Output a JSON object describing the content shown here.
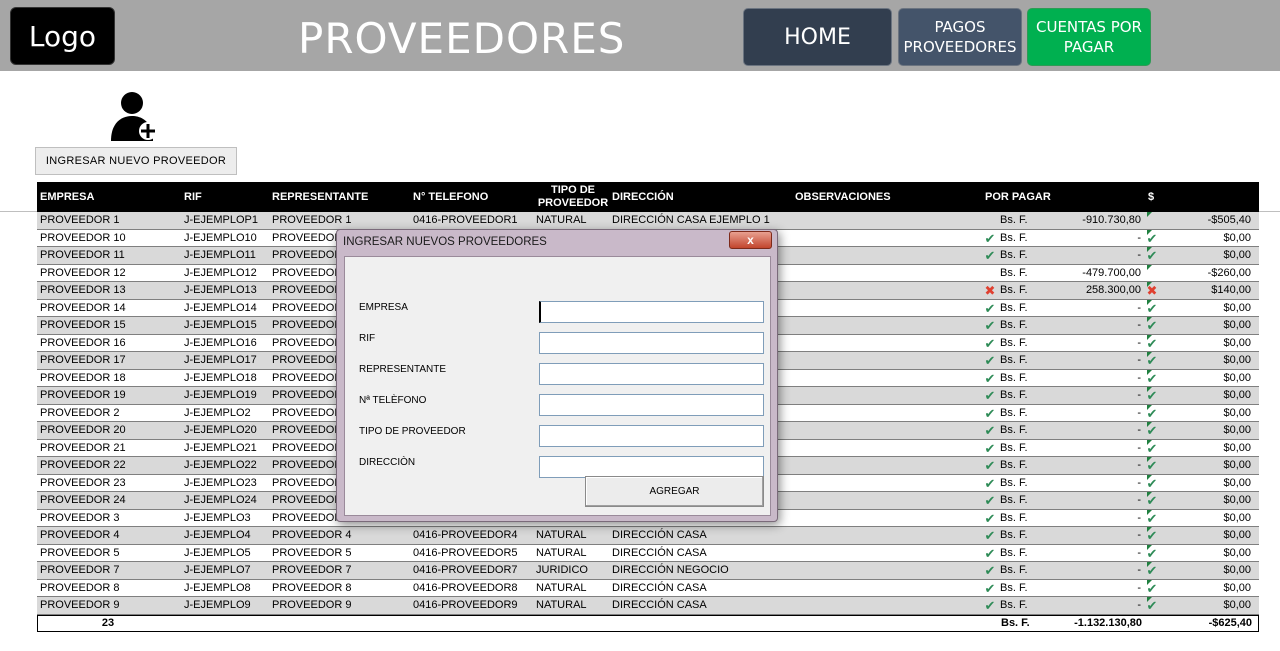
{
  "header": {
    "logo": "Logo",
    "title": "PROVEEDORES",
    "nav": {
      "home": "HOME",
      "pagos_line1": "PAGOS",
      "pagos_line2": "PROVEEDORES",
      "cuentas_line1": "CUENTAS POR",
      "cuentas_line2": "PAGAR"
    }
  },
  "new_provider_button": "INGRESAR NUEVO PROVEEDOR",
  "table": {
    "columns": {
      "empresa": "EMPRESA",
      "rif": "RIF",
      "representante": "REPRESENTANTE",
      "telefono": "N° TELEFONO",
      "tipo_line1": "TIPO DE",
      "tipo_line2": "PROVEEDOR",
      "direccion": "DIRECCIÓN",
      "observaciones": "OBSERVACIONES",
      "por_pagar": "POR PAGAR",
      "usd": "$"
    },
    "rows": [
      {
        "empresa": "PROVEEDOR 1",
        "rif": "J-EJEMPLOP1",
        "rep": "PROVEEDOR 1",
        "tel": "0416-PROVEEDOR1",
        "tipo": "NATURAL",
        "dir": "DIRECCIÓN CASA EJEMPLO 1",
        "mark1": "",
        "bs": "Bs. F.",
        "porpagar": "-910.730,80",
        "mark2": "",
        "usd": "-$505,40"
      },
      {
        "empresa": "PROVEEDOR 10",
        "rif": "J-EJEMPLO10",
        "rep": "PROVEEDOR",
        "tel": "",
        "tipo": "",
        "dir": "",
        "mark1": "ok",
        "bs": "Bs. F.",
        "porpagar": "-",
        "mark2": "ok",
        "usd": "$0,00"
      },
      {
        "empresa": "PROVEEDOR 11",
        "rif": "J-EJEMPLO11",
        "rep": "PROVEEDOR",
        "tel": "",
        "tipo": "",
        "dir": "",
        "mark1": "ok",
        "bs": "Bs. F.",
        "porpagar": "-",
        "mark2": "ok",
        "usd": "$0,00"
      },
      {
        "empresa": "PROVEEDOR 12",
        "rif": "J-EJEMPLO12",
        "rep": "PROVEEDOR",
        "tel": "",
        "tipo": "",
        "dir": "",
        "mark1": "",
        "bs": "Bs. F.",
        "porpagar": "-479.700,00",
        "mark2": "",
        "usd": "-$260,00"
      },
      {
        "empresa": "PROVEEDOR 13",
        "rif": "J-EJEMPLO13",
        "rep": "PROVEEDOR",
        "tel": "",
        "tipo": "",
        "dir": "",
        "mark1": "bad",
        "bs": "Bs. F.",
        "porpagar": "258.300,00",
        "mark2": "bad",
        "usd": "$140,00"
      },
      {
        "empresa": "PROVEEDOR 14",
        "rif": "J-EJEMPLO14",
        "rep": "PROVEEDOR",
        "tel": "",
        "tipo": "",
        "dir": "",
        "mark1": "ok",
        "bs": "Bs. F.",
        "porpagar": "-",
        "mark2": "ok",
        "usd": "$0,00"
      },
      {
        "empresa": "PROVEEDOR 15",
        "rif": "J-EJEMPLO15",
        "rep": "PROVEEDOR",
        "tel": "",
        "tipo": "",
        "dir": "",
        "mark1": "ok",
        "bs": "Bs. F.",
        "porpagar": "-",
        "mark2": "ok",
        "usd": "$0,00"
      },
      {
        "empresa": "PROVEEDOR 16",
        "rif": "J-EJEMPLO16",
        "rep": "PROVEEDOR",
        "tel": "",
        "tipo": "",
        "dir": "",
        "mark1": "ok",
        "bs": "Bs. F.",
        "porpagar": "-",
        "mark2": "ok",
        "usd": "$0,00"
      },
      {
        "empresa": "PROVEEDOR 17",
        "rif": "J-EJEMPLO17",
        "rep": "PROVEEDOR",
        "tel": "",
        "tipo": "",
        "dir": "",
        "mark1": "ok",
        "bs": "Bs. F.",
        "porpagar": "-",
        "mark2": "ok",
        "usd": "$0,00"
      },
      {
        "empresa": "PROVEEDOR 18",
        "rif": "J-EJEMPLO18",
        "rep": "PROVEEDOR",
        "tel": "",
        "tipo": "",
        "dir": "",
        "mark1": "ok",
        "bs": "Bs. F.",
        "porpagar": "-",
        "mark2": "ok",
        "usd": "$0,00"
      },
      {
        "empresa": "PROVEEDOR 19",
        "rif": "J-EJEMPLO19",
        "rep": "PROVEEDOR",
        "tel": "",
        "tipo": "",
        "dir": "",
        "mark1": "ok",
        "bs": "Bs. F.",
        "porpagar": "-",
        "mark2": "ok",
        "usd": "$0,00"
      },
      {
        "empresa": "PROVEEDOR 2",
        "rif": "J-EJEMPLO2",
        "rep": "PROVEEDOR",
        "tel": "",
        "tipo": "",
        "dir": "",
        "mark1": "ok",
        "bs": "Bs. F.",
        "porpagar": "-",
        "mark2": "ok",
        "usd": "$0,00"
      },
      {
        "empresa": "PROVEEDOR 20",
        "rif": "J-EJEMPLO20",
        "rep": "PROVEEDOR",
        "tel": "",
        "tipo": "",
        "dir": "",
        "mark1": "ok",
        "bs": "Bs. F.",
        "porpagar": "-",
        "mark2": "ok",
        "usd": "$0,00"
      },
      {
        "empresa": "PROVEEDOR 21",
        "rif": "J-EJEMPLO21",
        "rep": "PROVEEDOR",
        "tel": "",
        "tipo": "",
        "dir": "",
        "mark1": "ok",
        "bs": "Bs. F.",
        "porpagar": "-",
        "mark2": "ok",
        "usd": "$0,00"
      },
      {
        "empresa": "PROVEEDOR 22",
        "rif": "J-EJEMPLO22",
        "rep": "PROVEEDOR",
        "tel": "",
        "tipo": "",
        "dir": "",
        "mark1": "ok",
        "bs": "Bs. F.",
        "porpagar": "-",
        "mark2": "ok",
        "usd": "$0,00"
      },
      {
        "empresa": "PROVEEDOR 23",
        "rif": "J-EJEMPLO23",
        "rep": "PROVEEDOR",
        "tel": "",
        "tipo": "",
        "dir": "",
        "mark1": "ok",
        "bs": "Bs. F.",
        "porpagar": "-",
        "mark2": "ok",
        "usd": "$0,00"
      },
      {
        "empresa": "PROVEEDOR 24",
        "rif": "J-EJEMPLO24",
        "rep": "PROVEEDOR",
        "tel": "",
        "tipo": "",
        "dir": "",
        "mark1": "ok",
        "bs": "Bs. F.",
        "porpagar": "-",
        "mark2": "ok",
        "usd": "$0,00"
      },
      {
        "empresa": "PROVEEDOR 3",
        "rif": "J-EJEMPLO3",
        "rep": "PROVEEDOR",
        "tel": "",
        "tipo": "",
        "dir": "",
        "mark1": "ok",
        "bs": "Bs. F.",
        "porpagar": "-",
        "mark2": "ok",
        "usd": "$0,00"
      },
      {
        "empresa": "PROVEEDOR 4",
        "rif": "J-EJEMPLO4",
        "rep": "PROVEEDOR 4",
        "tel": "0416-PROVEEDOR4",
        "tipo": "NATURAL",
        "dir": "DIRECCIÓN CASA",
        "mark1": "ok",
        "bs": "Bs. F.",
        "porpagar": "-",
        "mark2": "ok",
        "usd": "$0,00"
      },
      {
        "empresa": "PROVEEDOR 5",
        "rif": "J-EJEMPLO5",
        "rep": "PROVEEDOR 5",
        "tel": "0416-PROVEEDOR5",
        "tipo": "NATURAL",
        "dir": "DIRECCIÓN CASA",
        "mark1": "ok",
        "bs": "Bs. F.",
        "porpagar": "-",
        "mark2": "ok",
        "usd": "$0,00"
      },
      {
        "empresa": "PROVEEDOR 7",
        "rif": "J-EJEMPLO7",
        "rep": "PROVEEDOR 7",
        "tel": "0416-PROVEEDOR7",
        "tipo": "JURIDICO",
        "dir": "DIRECCIÓN NEGOCIO",
        "mark1": "ok",
        "bs": "Bs. F.",
        "porpagar": "-",
        "mark2": "ok",
        "usd": "$0,00"
      },
      {
        "empresa": "PROVEEDOR 8",
        "rif": "J-EJEMPLO8",
        "rep": "PROVEEDOR 8",
        "tel": "0416-PROVEEDOR8",
        "tipo": "NATURAL",
        "dir": "DIRECCIÓN CASA",
        "mark1": "ok",
        "bs": "Bs. F.",
        "porpagar": "-",
        "mark2": "ok",
        "usd": "$0,00"
      },
      {
        "empresa": "PROVEEDOR 9",
        "rif": "J-EJEMPLO9",
        "rep": "PROVEEDOR 9",
        "tel": "0416-PROVEEDOR9",
        "tipo": "NATURAL",
        "dir": "DIRECCIÓN CASA",
        "mark1": "ok",
        "bs": "Bs. F.",
        "porpagar": "-",
        "mark2": "ok",
        "usd": "$0,00"
      }
    ],
    "footer": {
      "count": "23",
      "bs": "Bs. F.",
      "porpagar": "-1.132.130,80",
      "usd": "-$625,40"
    }
  },
  "modal": {
    "title": "INGRESAR NUEVOS PROVEEDORES",
    "close": "x",
    "fields": [
      {
        "label": "EMPRESA",
        "value": ""
      },
      {
        "label": "RIF",
        "value": ""
      },
      {
        "label": "REPRESENTANTE",
        "value": ""
      },
      {
        "label": "Nª TELÈFONO",
        "value": ""
      },
      {
        "label": "TIPO DE PROVEEDOR",
        "value": ""
      },
      {
        "label": "DIRECCIÒN",
        "value": ""
      }
    ],
    "submit": "AGREGAR"
  },
  "colors": {
    "header_bg": "#a6a6a6",
    "home_btn": "#323e4f",
    "pagos_btn": "#44546a",
    "cuentas_btn": "#00b050",
    "ok_mark": "#2e8b57",
    "bad_mark": "#e04030"
  },
  "icons": {
    "add_user": "add-user-icon",
    "ok": "check-icon",
    "bad": "cross-icon"
  }
}
